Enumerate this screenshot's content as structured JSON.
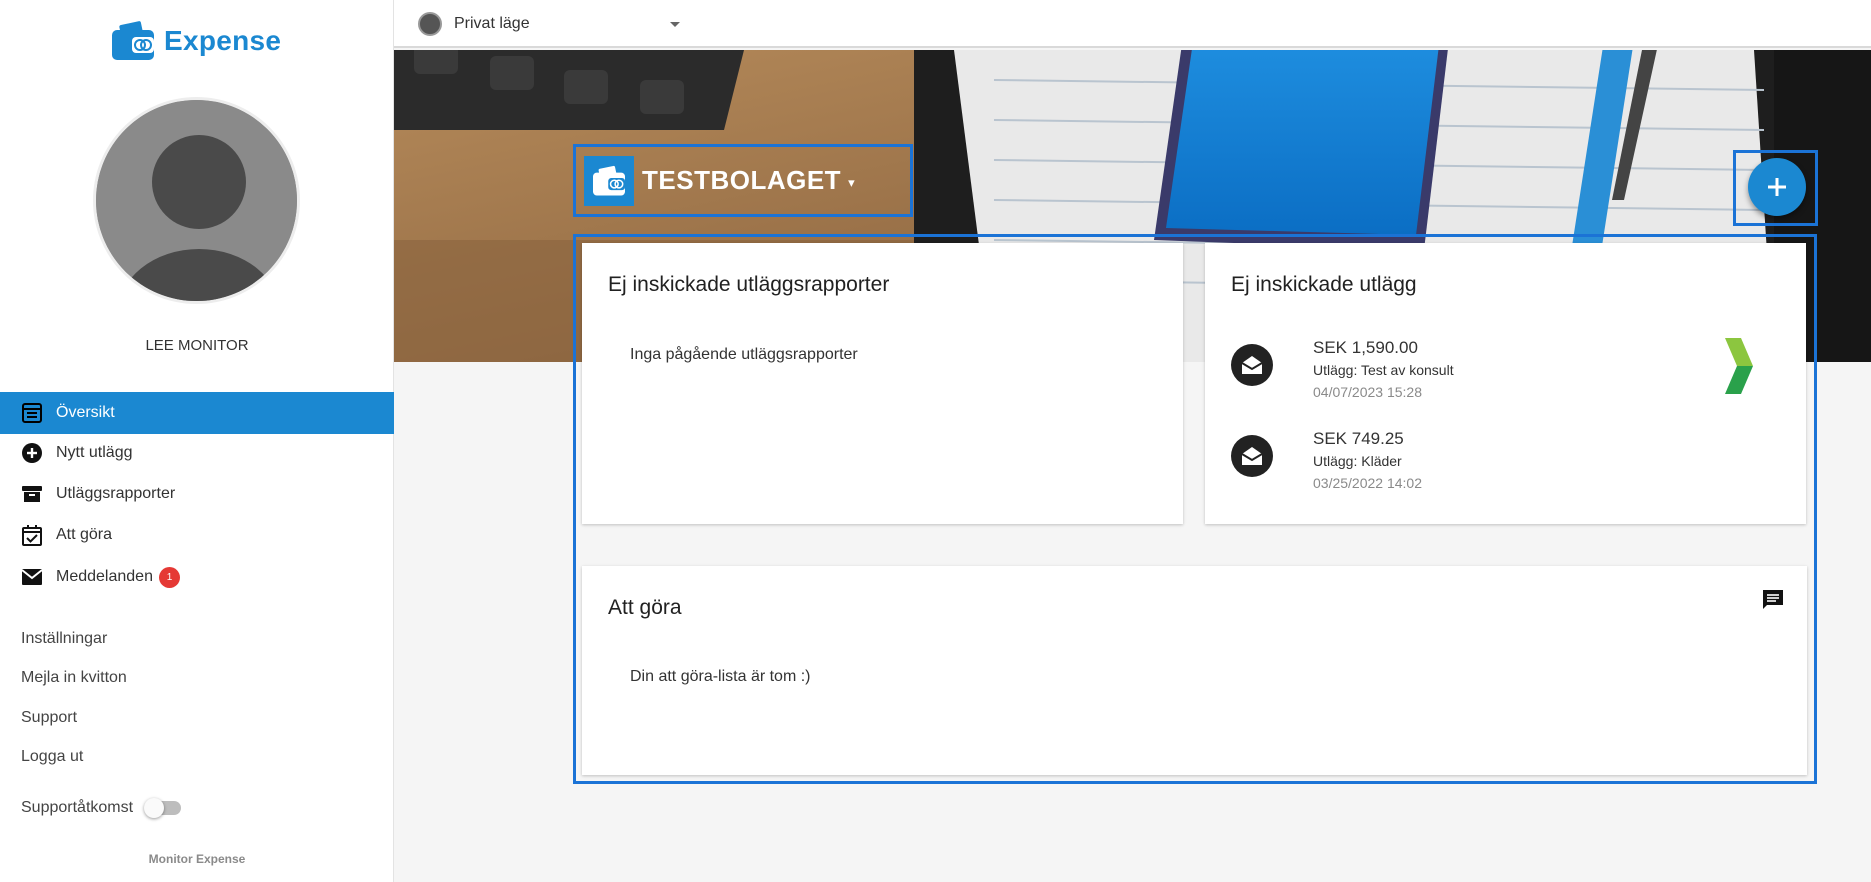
{
  "app": {
    "brand_name": "Expense",
    "footer_brand": "Monitor Expense"
  },
  "user": {
    "name": "LEE MONITOR"
  },
  "topbar": {
    "mode_label": "Privat läge"
  },
  "sidebar": {
    "nav": [
      {
        "label": "Översikt",
        "icon": "overview-icon",
        "active": true
      },
      {
        "label": "Nytt utlägg",
        "icon": "add-circle-icon"
      },
      {
        "label": "Utläggsrapporter",
        "icon": "archive-icon"
      },
      {
        "label": "Att göra",
        "icon": "calendar-check-icon"
      },
      {
        "label": "Meddelanden",
        "icon": "mail-icon",
        "badge": "1"
      }
    ],
    "links": [
      "Inställningar",
      "Mejla in kvitton",
      "Support",
      "Logga ut"
    ],
    "support_access_label": "Supportåtkomst",
    "support_access_on": false
  },
  "hero": {
    "company_name": "TESTBOLAGET",
    "company_caret": "▾"
  },
  "cards": {
    "reports": {
      "title": "Ej inskickade utläggsrapporter",
      "empty_text": "Inga pågående utläggsrapporter"
    },
    "expenses": {
      "title": "Ej inskickade utlägg",
      "items": [
        {
          "amount": "SEK 1,590.00",
          "desc": "Utlägg: Test av konsult",
          "date": "04/07/2023 15:28"
        },
        {
          "amount": "SEK 749.25",
          "desc": "Utlägg: Kläder",
          "date": "03/25/2022 14:02"
        }
      ]
    },
    "todo": {
      "title": "Att göra",
      "empty_text": "Din att göra-lista är tom :)"
    }
  },
  "colors": {
    "accent": "#1b88d1",
    "highlight_border": "#1b73d6",
    "badge": "#e53935"
  }
}
